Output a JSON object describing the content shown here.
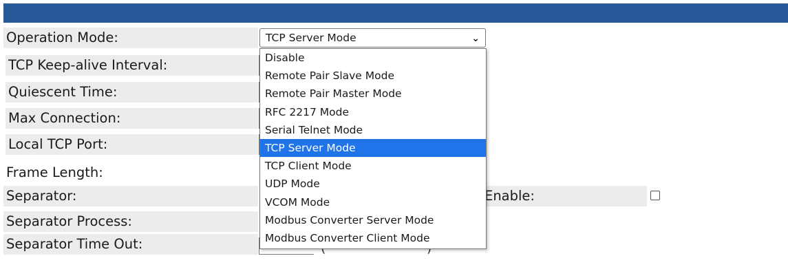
{
  "form": {
    "operation_mode_label": "Operation Mode:",
    "keepalive_label": "TCP Keep-alive Interval:",
    "quiescent_label": "Quiescent Time:",
    "max_connection_label": "Max Connection:",
    "local_port_label": "Local TCP Port:",
    "frame_length_label": "Frame Length:",
    "separator_label": "Separator:",
    "separator_process_label": "Separator Process:",
    "separator_timeout_label": "Separator Time Out:",
    "enable_label": "Enable:"
  },
  "operation_mode": {
    "selected": "TCP Server Mode",
    "options": [
      "Disable",
      "Remote Pair Slave Mode",
      "Remote Pair Master Mode",
      "RFC 2217 Mode",
      "Serial Telnet Mode",
      "TCP Server Mode",
      "TCP Client Mode",
      "UDP Mode",
      "VCOM Mode",
      "Modbus Converter Server Mode",
      "Modbus Converter Client Mode"
    ],
    "selected_index": 5
  },
  "colors": {
    "header_bar": "#285a9a",
    "highlight": "#1e74e8",
    "label_bg": "#ececec"
  }
}
